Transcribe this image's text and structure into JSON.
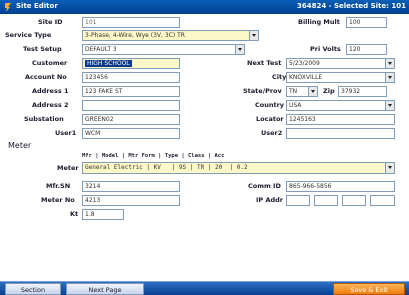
{
  "titlebar": {
    "title": "Site Editor",
    "status": "364824 - Selected Site: 101"
  },
  "fields": {
    "site_id": {
      "label": "Site ID",
      "value": "101"
    },
    "billing_mult": {
      "label": "Billing Mult",
      "value": "100"
    },
    "service_type": {
      "label": "Service Type",
      "value": "3-Phase, 4-Wire, Wye (3V, 3C) TR"
    },
    "test_setup": {
      "label": "Test Setup",
      "value": "DEFAULT 3"
    },
    "pri_volts": {
      "label": "Pri Volts",
      "value": "120"
    },
    "customer": {
      "label": "Customer",
      "value": "HIGH SCHOOL"
    },
    "next_test": {
      "label": "Next Test",
      "value": "5/23/2009"
    },
    "account_no": {
      "label": "Account No",
      "value": "123456"
    },
    "city": {
      "label": "City",
      "value": "KNOXVILLE"
    },
    "address1": {
      "label": "Address 1",
      "value": "123 FAKE ST"
    },
    "state": {
      "label": "State/Prov",
      "value": "TN"
    },
    "zip": {
      "label": "Zip",
      "value": "37932"
    },
    "address2": {
      "label": "Address 2",
      "value": ""
    },
    "country": {
      "label": "Country",
      "value": "USA"
    },
    "substation": {
      "label": "Substation",
      "value": "GREEN02"
    },
    "locator": {
      "label": "Locator",
      "value": "1245163"
    },
    "user1": {
      "label": "User1",
      "value": "WCM"
    },
    "user2": {
      "label": "User2",
      "value": ""
    }
  },
  "meter_section": {
    "heading": "Meter",
    "column_header": "Mfr | Model | Mtr Form | Type | Class | Acc",
    "meter": {
      "label": "Meter",
      "value": "General Electric | KV   | 9S | TR | 20  | 0.2"
    },
    "mfr_sn": {
      "label": "Mfr.SN",
      "value": "3214"
    },
    "comm_id": {
      "label": "Comm ID",
      "value": "865-966-5856"
    },
    "meter_no": {
      "label": "Meter No",
      "value": "4213"
    },
    "ip_addr": {
      "label": "IP Addr",
      "values": [
        "",
        "",
        "",
        ""
      ]
    },
    "kt": {
      "label": "Kt",
      "value": "1.8"
    }
  },
  "bottom": {
    "section_label": "Section",
    "next_page_label": "Next Page",
    "save_exit_label": "Save & Exit"
  },
  "colors": {
    "titlebar": "#0a5fb6",
    "yellow_field": "#fdf8c8",
    "save_button": "#f07d0a"
  }
}
